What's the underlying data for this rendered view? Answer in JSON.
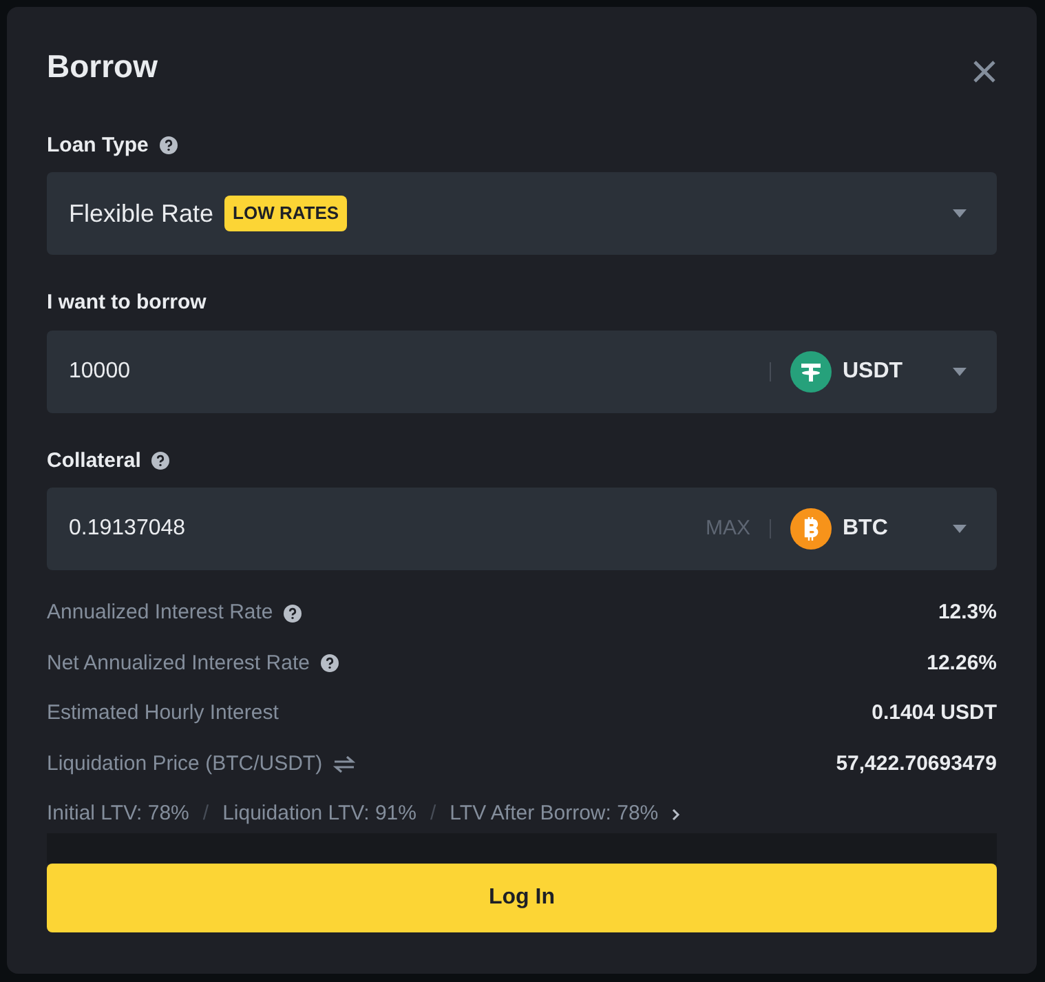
{
  "dialog": {
    "title": "Borrow"
  },
  "loan_type": {
    "label": "Loan Type",
    "help": true,
    "value": "Flexible Rate",
    "badge": "LOW RATES"
  },
  "borrow": {
    "label": "I want to borrow",
    "help": false,
    "value": "10000",
    "coin": "USDT",
    "kind": "tether"
  },
  "collateral": {
    "label": "Collateral",
    "help": true,
    "value": "0.19137048",
    "coin": "BTC",
    "kind": "bitcoin",
    "max": "MAX"
  },
  "details": [
    {
      "label": "Annualized Interest Rate",
      "kind": "help",
      "value": "12.3%"
    },
    {
      "label": "Net Annualized Interest Rate",
      "kind": "help",
      "value": "12.26%"
    },
    {
      "label": "Estimated Hourly Interest",
      "kind": "plain",
      "value": "0.1404 USDT"
    },
    {
      "label": "Liquidation Price (BTC/USDT)",
      "kind": "swap",
      "value": "57,422.70693479"
    }
  ],
  "ltv": {
    "items": [
      "Initial LTV: 78%",
      "Liquidation LTV: 91%",
      "LTV After Borrow: 78%"
    ],
    "separator": "/"
  },
  "button": "Log In"
}
